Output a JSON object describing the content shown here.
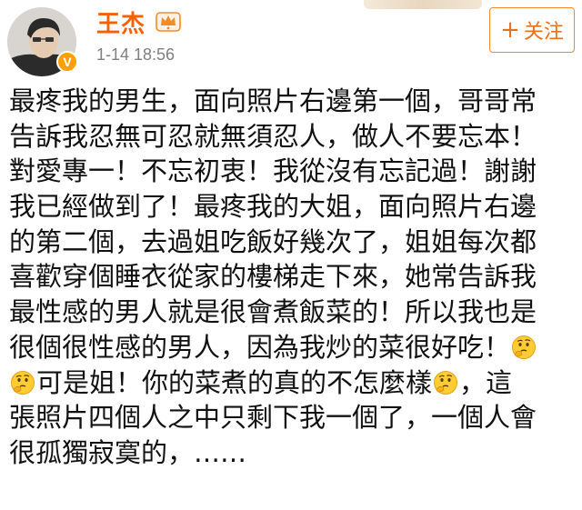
{
  "post": {
    "author": "王杰",
    "timestamp": "1-14 18:56",
    "follow_label": "关注",
    "follow_plus": "+",
    "lines": [
      [
        "最疼我的男生，面向照片右邊第一個，哥哥常"
      ],
      [
        "告訴我忍無可忍就無須忍人，做人不要忘本！"
      ],
      [
        "對愛專一！不忘初衷！我從沒有忘記過！謝謝"
      ],
      [
        "我已經做到了！最疼我的大姐，面向照片右邊"
      ],
      [
        "的第二個，去過姐吃飯好幾次了，姐姐每次都"
      ],
      [
        "喜歡穿個睡衣從家的樓梯走下來，她常告訴我"
      ],
      [
        "最性感的男人就是很會煮飯菜的！所以我也是"
      ],
      [
        "很個很性感的男人，因為我炒的菜很好吃！"
      ],
      [
        "可是姐！你的菜煮的真的不怎麼樣",
        "，這"
      ],
      [
        "張照片四個人之中只剩下我一個了，一個人會"
      ],
      [
        "很孤獨寂寞的，……"
      ]
    ],
    "emoji_name": "thinking-face-emoji",
    "colors": {
      "username": "#f86000",
      "verified_badge": "#ff9f00",
      "follow_border": "#f08a2c",
      "text": "#111111",
      "timestamp": "#808080"
    }
  }
}
